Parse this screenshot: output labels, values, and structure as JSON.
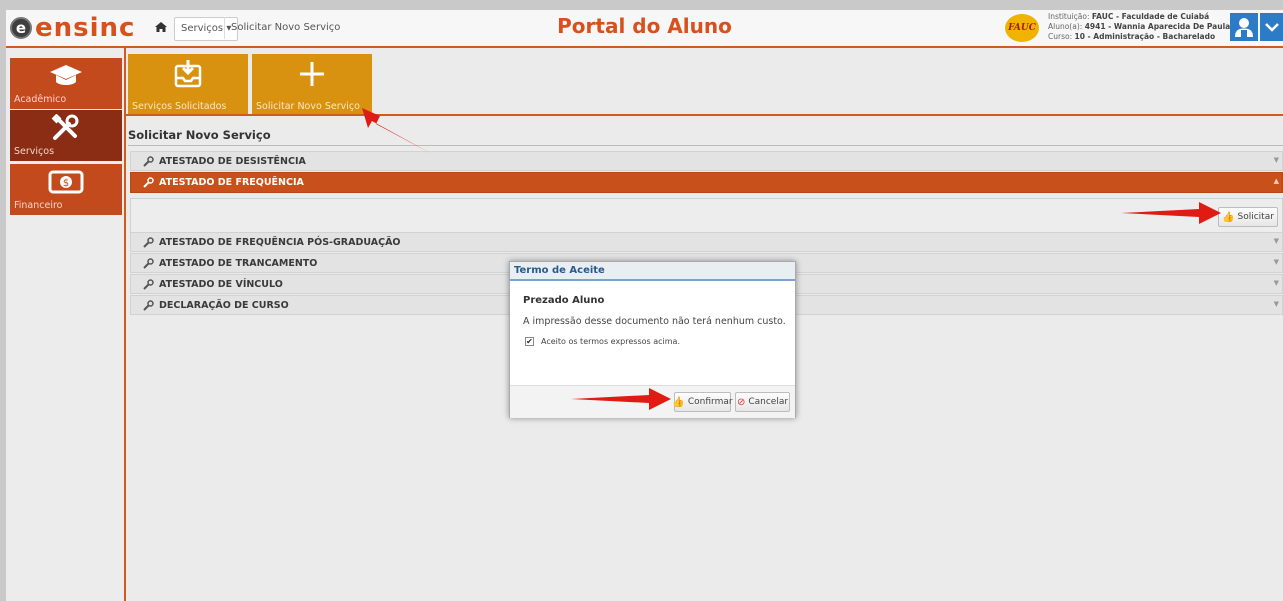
{
  "header": {
    "logo_badge": "e",
    "logo_text": "ensinc",
    "nav_dropdown_label": "Serviços",
    "nav_breadcrumb": "Solicitar Novo Serviço",
    "portal_title": "Portal do Aluno",
    "fauc_logo_text": "FAUC",
    "institution_label": "Instituição:",
    "institution_value": "FAUC - Faculdade de Cuiabá",
    "student_label": "Aluno(a):",
    "student_value": "4941 - Wannia Aparecida De Paula",
    "course_label": "Curso:",
    "course_value": "10 - Administração - Bacharelado"
  },
  "sidebar": {
    "items": [
      {
        "label": "Acadêmico",
        "icon": "graduation-cap-icon"
      },
      {
        "label": "Serviços",
        "icon": "tools-icon"
      },
      {
        "label": "Financeiro",
        "icon": "money-icon"
      }
    ]
  },
  "tiles": [
    {
      "label": "Serviços Solicitados",
      "icon": "inbox-download-icon"
    },
    {
      "label": "Solicitar Novo Serviço",
      "icon": "plus-icon"
    }
  ],
  "services": {
    "title": "Solicitar Novo Serviço",
    "items": [
      "ATESTADO DE DESISTÊNCIA",
      "ATESTADO DE FREQUÊNCIA",
      "ATESTADO DE FREQUÊNCIA PÓS-GRADUAÇÃO",
      "ATESTADO DE TRANCAMENTO",
      "ATESTADO DE VÍNCULO",
      "DECLARAÇÃO DE CURSO"
    ],
    "open_index": 1,
    "solicitar_label": "Solicitar"
  },
  "modal": {
    "title": "Termo de Aceite",
    "heading": "Prezado Aluno",
    "text": "A impressão desse documento não terá nenhum custo.",
    "checkbox_label": "Aceito os termos expressos acima.",
    "checkbox_checked": true,
    "confirm_label": "Confirmar",
    "cancel_label": "Cancelar"
  },
  "colors": {
    "brand_orange": "#d8501c",
    "tile_gold": "#d9920f",
    "accordion_open": "#c8501a",
    "accent_blue": "#2c7bc7",
    "arrow_red": "#e01b14"
  }
}
